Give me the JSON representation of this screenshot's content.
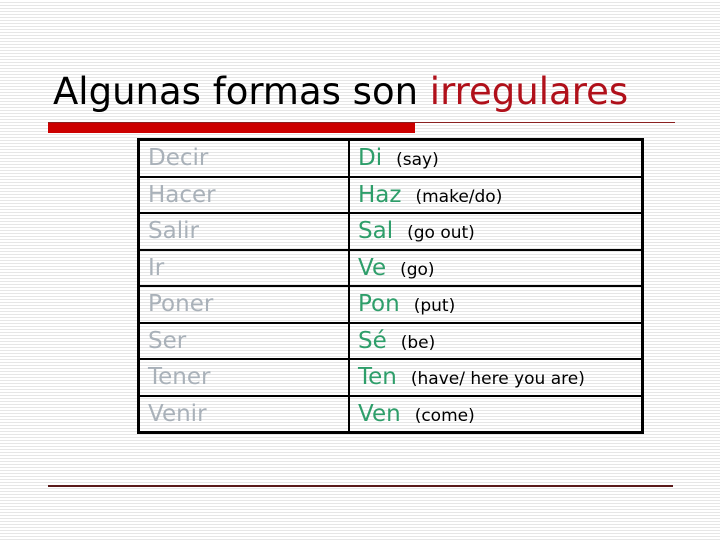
{
  "slide": {
    "title_main": "Algunas formas son ",
    "title_accent": "irregulares",
    "colors": {
      "accent_red": "#cc0000",
      "infinitive_gray": "#a9b1b9",
      "imperative_green": "#2e9e6a"
    }
  },
  "table": {
    "rows": [
      {
        "infinitive": "Decir",
        "imperative": "Di",
        "gloss": "(say)"
      },
      {
        "infinitive": "Hacer",
        "imperative": "Haz",
        "gloss": "(make/do)"
      },
      {
        "infinitive": "Salir",
        "imperative": "Sal",
        "gloss": "(go out)"
      },
      {
        "infinitive": "Ir",
        "imperative": "Ve",
        "gloss": "(go)"
      },
      {
        "infinitive": "Poner",
        "imperative": "Pon",
        "gloss": "(put)"
      },
      {
        "infinitive": "Ser",
        "imperative": "Sé",
        "gloss": "(be)"
      },
      {
        "infinitive": "Tener",
        "imperative": "Ten",
        "gloss": "(have/ here you are)"
      },
      {
        "infinitive": "Venir",
        "imperative": "Ven",
        "gloss": "(come)"
      }
    ]
  }
}
